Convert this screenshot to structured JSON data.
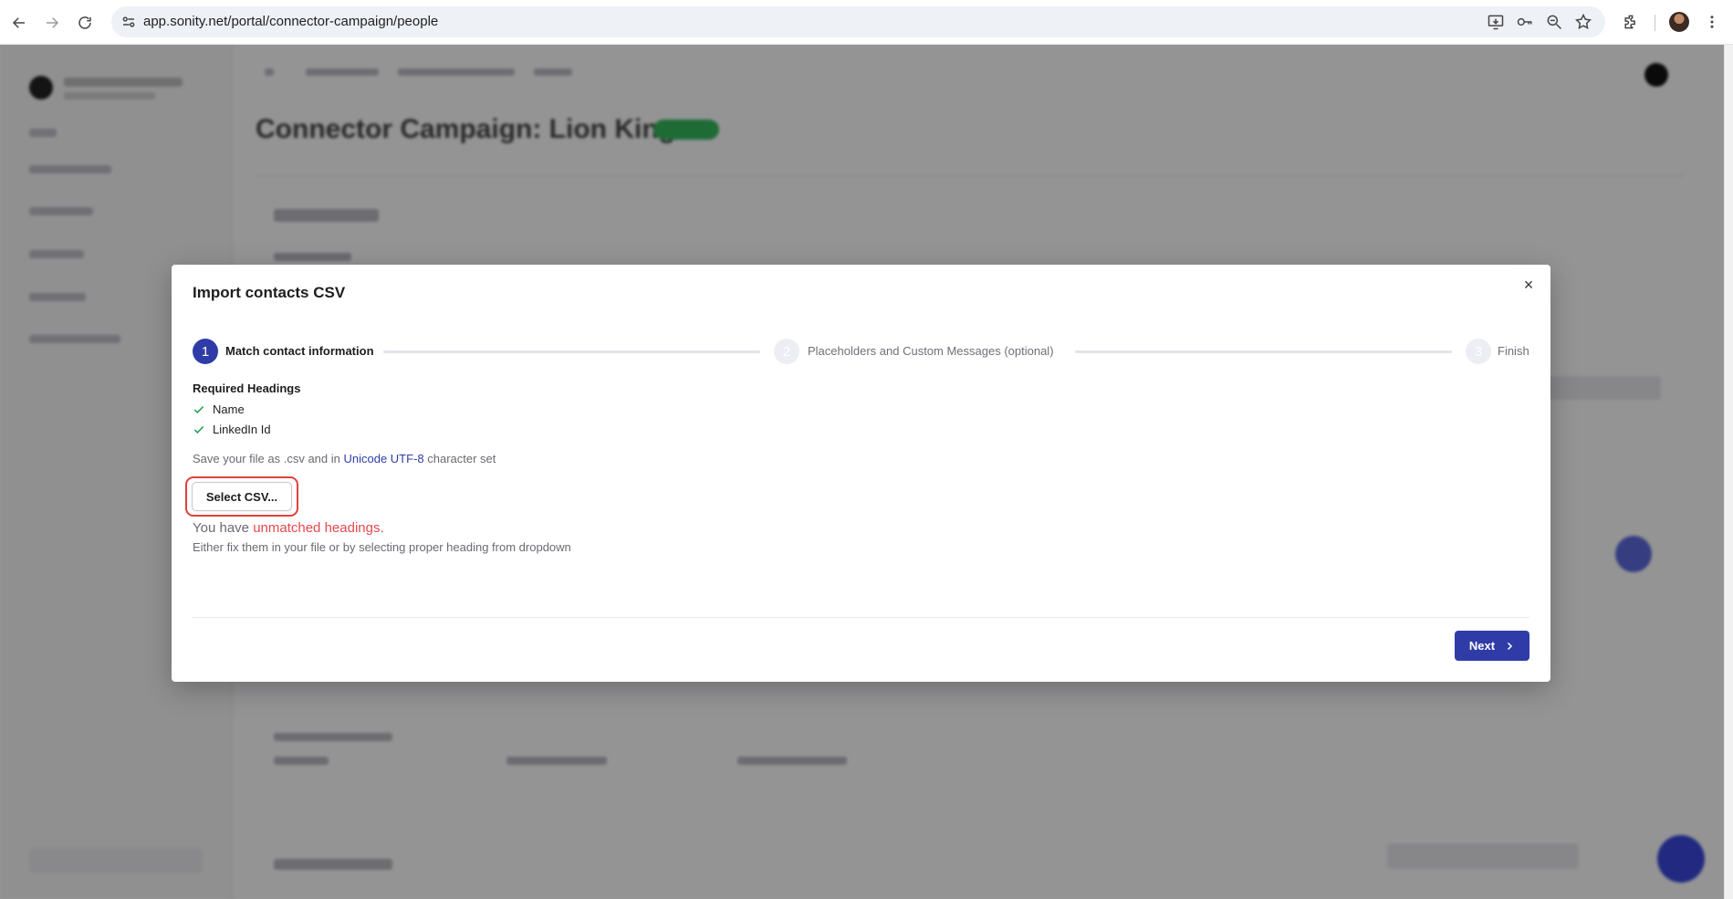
{
  "browser": {
    "url": "app.sonity.net/portal/connector-campaign/people"
  },
  "background": {
    "page_title": "Connector Campaign: Lion King"
  },
  "modal": {
    "title": "Import contacts CSV",
    "close_label": "×",
    "steps": [
      {
        "number": "1",
        "label": "Match contact information",
        "state": "active"
      },
      {
        "number": "2",
        "label": "Placeholders and Custom Messages (optional)",
        "state": "inactive"
      },
      {
        "number": "3",
        "label": "Finish",
        "state": "inactive"
      }
    ],
    "required_headings_title": "Required Headings",
    "required_headings": [
      "Name",
      "LinkedIn Id"
    ],
    "save_note": {
      "prefix": "Save your file as .csv and in ",
      "link": "Unicode UTF-8",
      "suffix": " character set"
    },
    "select_csv_label": "Select CSV...",
    "unmatched": {
      "prefix": "You have ",
      "highlight": "unmatched headings",
      "suffix": "."
    },
    "unmatched_help": "Either fix them in your file or by selecting proper heading from dropdown",
    "next_label": "Next"
  },
  "colors": {
    "primary": "#2f3ca8",
    "error": "#e5484d",
    "success": "#1a9b4b",
    "highlight_ring": "#e0413a"
  }
}
